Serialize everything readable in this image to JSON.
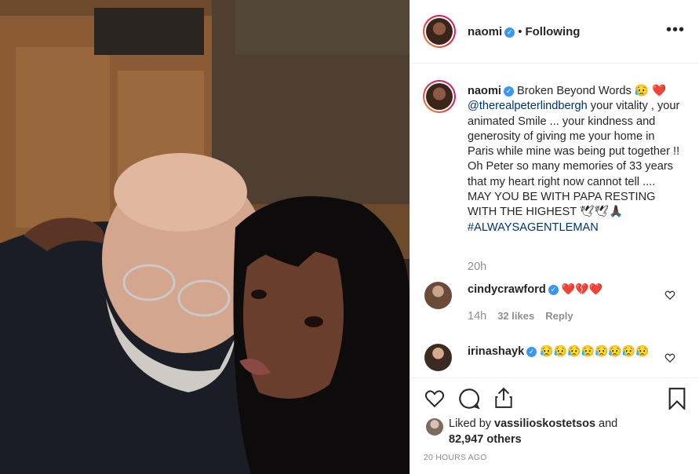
{
  "post": {
    "image_alt": "Selfie of two people",
    "header": {
      "username": "naomi",
      "separator": "•",
      "follow_status": "Following",
      "more_glyph": "•••"
    },
    "caption": {
      "username": "naomi",
      "text_1": " Broken Beyond Words 😥",
      "heart": "❤️",
      "mention": "@therealpeterlindbergh",
      "text_2": " your vitality , your animated Smile ... your kindness and generosity of giving me your home in Paris while mine was being put together !! Oh Peter so many memories of 33 years that my heart right now cannot tell .... MAY YOU BE WITH PAPA RESTING WITH THE HIGHEST 🕊🕊🙏🏿",
      "hashtag": "#ALWAYSAGENTLEMAN",
      "time": "20h"
    },
    "comments": [
      {
        "username": "cindycrawford",
        "text": "❤️💔❤️",
        "time": "14h",
        "likes": "32 likes",
        "reply": "Reply"
      },
      {
        "username": "irinashayk",
        "text": "😥😥😥😥😥😥😥😥"
      }
    ],
    "likes": {
      "prefix": "Liked by ",
      "user": "vassilioskostetsos",
      "middle": " and",
      "count": "82,947 others"
    },
    "timestamp": "20 HOURS AGO"
  },
  "icons": {
    "like": "heart-icon",
    "comment": "comment-icon",
    "share": "share-icon",
    "save": "bookmark-icon",
    "verified": "verified-badge-icon"
  },
  "colors": {
    "verified": "#3897f0",
    "mention": "#003569",
    "muted": "#8e8e8e",
    "text": "#262626"
  }
}
